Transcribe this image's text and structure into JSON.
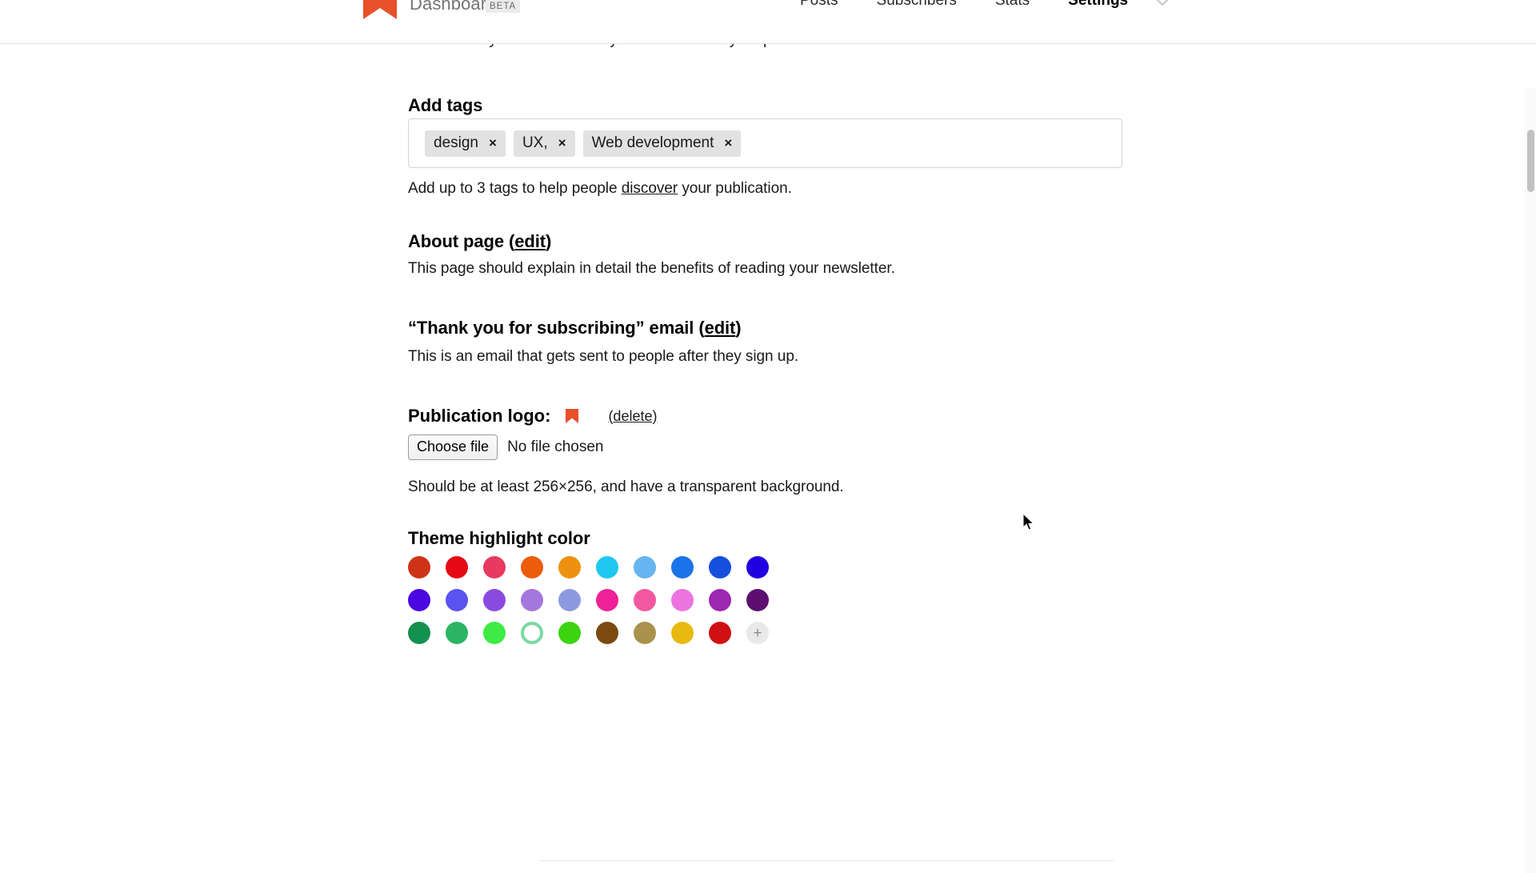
{
  "header": {
    "brand": "Dashboard",
    "beta_badge": "BETA",
    "logo_icon": "bookmark-logo-icon",
    "logo_color": "#e8502a",
    "caret_icon": "chevron-down-icon",
    "nav": [
      {
        "label": "Posts",
        "active": false
      },
      {
        "label": "Subscribers",
        "active": false
      },
      {
        "label": "Stats",
        "active": false
      },
      {
        "label": "Settings",
        "active": true
      }
    ]
  },
  "main": {
    "clipped_top_text": "automatically shown this if they haven't been to your publication before.",
    "tags": {
      "title": "Add tags",
      "items": [
        {
          "label": "design",
          "remove": "×"
        },
        {
          "label": "UX,",
          "remove": "×"
        },
        {
          "label": "Web development",
          "remove": "×"
        }
      ],
      "help_before": "Add up to 3 tags to help people ",
      "help_link": "discover",
      "help_after": " your publication."
    },
    "about": {
      "title_before": "About page (",
      "title_link": "edit",
      "title_after": ")",
      "description": "This page should explain in detail the benefits of reading your newsletter."
    },
    "thank_you": {
      "title_before": "“Thank you for subscribing” email (",
      "title_link": "edit",
      "title_after": ")",
      "description": "This is an email that gets sent to people after they sign up."
    },
    "publication_logo": {
      "label": "Publication logo:",
      "thumb_icon": "bookmark-logo-icon",
      "thumb_color": "#e8502a",
      "delete_label": "(delete)",
      "choose_file_label": "Choose file",
      "file_status": "No file chosen",
      "help": "Should be at least 256×256, and have a transparent background."
    },
    "theme": {
      "title": "Theme highlight color",
      "add_label": "+",
      "add_icon": "plus-icon",
      "rows": [
        [
          {
            "color": "#cf3316",
            "selected": false
          },
          {
            "color": "#e50914",
            "selected": false
          },
          {
            "color": "#e8395f",
            "selected": false
          },
          {
            "color": "#ec5c0c",
            "selected": false
          },
          {
            "color": "#ef9110",
            "selected": false
          },
          {
            "color": "#1fc8f0",
            "selected": false
          },
          {
            "color": "#66b4f0",
            "selected": false
          },
          {
            "color": "#1a73e8",
            "selected": false
          },
          {
            "color": "#1450dc",
            "selected": false
          },
          {
            "color": "#2200e0",
            "selected": false
          }
        ],
        [
          {
            "color": "#4a07e0",
            "selected": false
          },
          {
            "color": "#5b52ef",
            "selected": false
          },
          {
            "color": "#8a4ae0",
            "selected": false
          },
          {
            "color": "#a477dd",
            "selected": false
          },
          {
            "color": "#8e9ae0",
            "selected": false
          },
          {
            "color": "#ef2196",
            "selected": false
          },
          {
            "color": "#f2589f",
            "selected": false
          },
          {
            "color": "#ec74e0",
            "selected": false
          },
          {
            "color": "#9c27b0",
            "selected": false
          },
          {
            "color": "#5c0f6e",
            "selected": false
          }
        ],
        [
          {
            "color": "#14914f",
            "selected": false
          },
          {
            "color": "#2bb563",
            "selected": false
          },
          {
            "color": "#3ceb44",
            "selected": false
          },
          {
            "color": "#7bd8a0",
            "selected": true
          },
          {
            "color": "#3cd311",
            "selected": false
          },
          {
            "color": "#7a4a10",
            "selected": false
          },
          {
            "color": "#a9924b",
            "selected": false
          },
          {
            "color": "#e8b910",
            "selected": false
          },
          {
            "color": "#cf1111",
            "selected": false
          }
        ]
      ]
    }
  }
}
